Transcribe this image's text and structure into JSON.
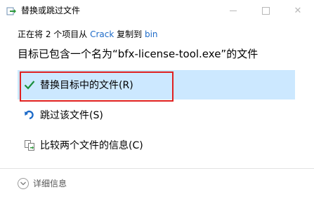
{
  "window": {
    "title": "替换或跳过文件",
    "minimize_icon": "minimize-icon",
    "maximize_icon": "maximize-icon",
    "close_icon": "close-icon",
    "close_glyph": "✕"
  },
  "status": {
    "prefix": "正在将 2 个项目从 ",
    "source": "Crack",
    "middle": " 复制到 ",
    "destination": "bin"
  },
  "heading": "目标已包含一个名为“bfx-license-tool.exe”的文件",
  "options": [
    {
      "label": "替换目标中的文件(R)",
      "icon": "checkmark-icon",
      "selected": true
    },
    {
      "label": "跳过该文件(S)",
      "icon": "skip-arrow-icon",
      "selected": false
    },
    {
      "label": "比较两个文件的信息(C)",
      "icon": "compare-files-icon",
      "selected": false
    }
  ],
  "footer": {
    "details_label": "详细信息",
    "details_icon": "chevron-down-icon"
  },
  "colors": {
    "selected_bg": "#cce8ff",
    "highlight_border": "#e02020",
    "link": "#1c6ac8",
    "checkmark": "#1a8f3c"
  }
}
